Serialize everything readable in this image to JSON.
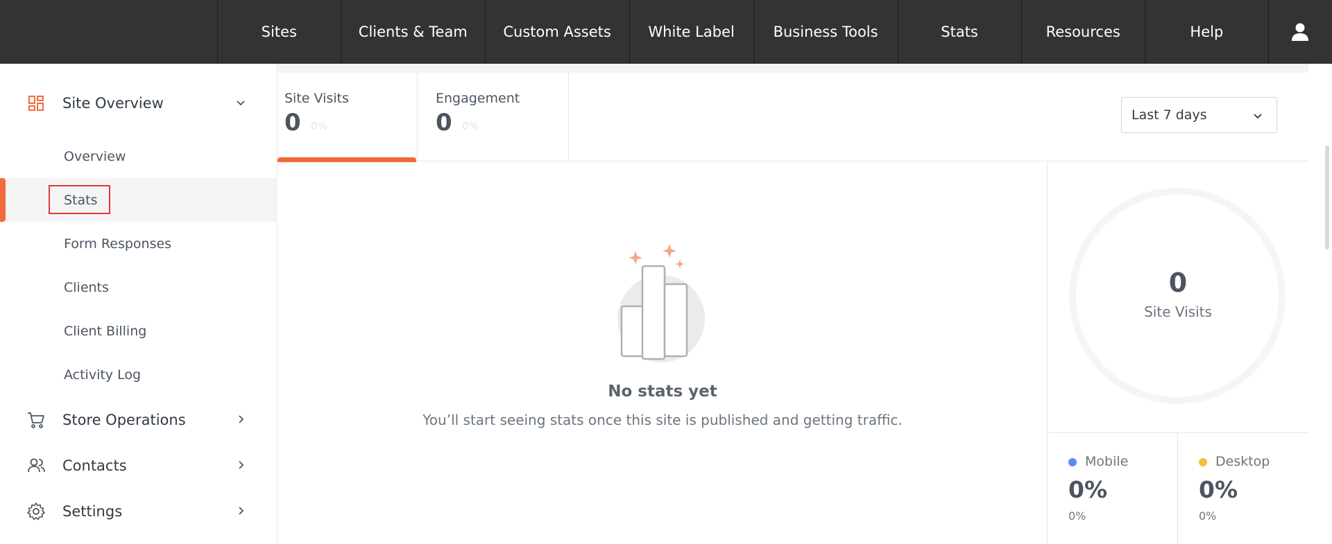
{
  "topnav": {
    "items": [
      "Sites",
      "Clients & Team",
      "Custom Assets",
      "White Label",
      "Business Tools",
      "Stats",
      "Resources",
      "Help"
    ]
  },
  "sidebar": {
    "site_overview": {
      "label": "Site Overview",
      "items": [
        "Overview",
        "Stats",
        "Form Responses",
        "Clients",
        "Client Billing",
        "Activity Log"
      ],
      "active": "Stats"
    },
    "store_operations": "Store Operations",
    "contacts": "Contacts",
    "settings": "Settings"
  },
  "tabs": [
    {
      "label": "Site Visits",
      "value": "0",
      "pct": "0%"
    },
    {
      "label": "Engagement",
      "value": "0",
      "pct": "0%"
    }
  ],
  "range": {
    "label": "Last 7 days"
  },
  "empty": {
    "title": "No stats yet",
    "subtitle": "You’ll start seeing stats once this site is published and getting traffic."
  },
  "summary": {
    "value": "0",
    "label": "Site Visits"
  },
  "devices": [
    {
      "label": "Mobile",
      "pct": "0%",
      "sub": "0%",
      "color": "#5b8def"
    },
    {
      "label": "Desktop",
      "pct": "0%",
      "sub": "0%",
      "color": "#f5bf3c"
    }
  ],
  "colors": {
    "accent": "#f26b3a",
    "nav_bg": "#333333"
  },
  "icons": {
    "site_overview": "grid-icon",
    "store_operations": "cart-icon",
    "contacts": "users-icon",
    "settings": "gear-icon",
    "user": "user-icon"
  }
}
